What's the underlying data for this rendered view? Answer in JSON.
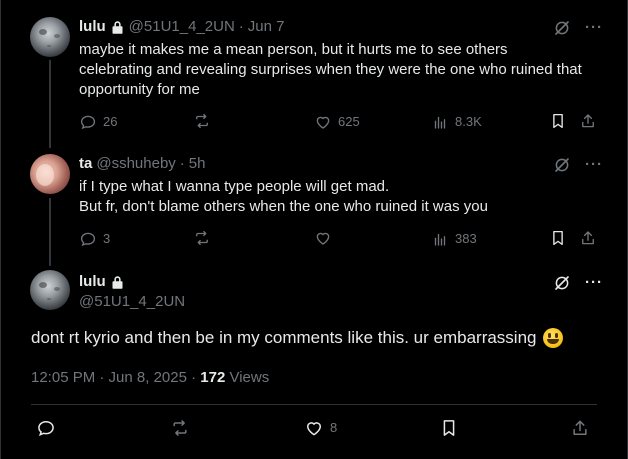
{
  "tweets": [
    {
      "name": "lulu",
      "handle": "@51U1_4_2UN",
      "time": "Jun 7",
      "lines": [
        "maybe it makes me a mean person, but it hurts me to see others",
        "celebrating and revealing surprises when they were the one who ruined that",
        "opportunity for me"
      ],
      "replies": "26",
      "retweets": "",
      "likes": "625",
      "views": "8.3K"
    },
    {
      "name": "ta",
      "handle": "@sshuheby",
      "time": "5h",
      "lines": [
        "if I type what I wanna type people will get mad.",
        "But fr, don't blame others when the one who ruined it was you"
      ],
      "replies": "3",
      "retweets": "",
      "likes": "",
      "views": "383"
    }
  ],
  "main": {
    "name": "lulu",
    "handle": "@51U1_4_2UN",
    "text": "dont rt kyrio and then be in my comments like this. ur embarrassing",
    "timestamp": "12:05 PM · Jun 8, 2025 · ",
    "views_count": "172",
    "views_label": " Views",
    "likes": "8"
  },
  "icons": {
    "reply": "reply-icon",
    "retweet": "retweet-icon",
    "like": "heart-icon",
    "views": "views-icon",
    "bookmark": "bookmark-icon",
    "share": "share-icon",
    "grok": "grok-icon",
    "more": "more-icon",
    "lock": "lock-icon"
  },
  "colors": {
    "background": "#000000",
    "text": "#e7e9ea",
    "muted": "#71767b",
    "border": "#2f3336"
  }
}
